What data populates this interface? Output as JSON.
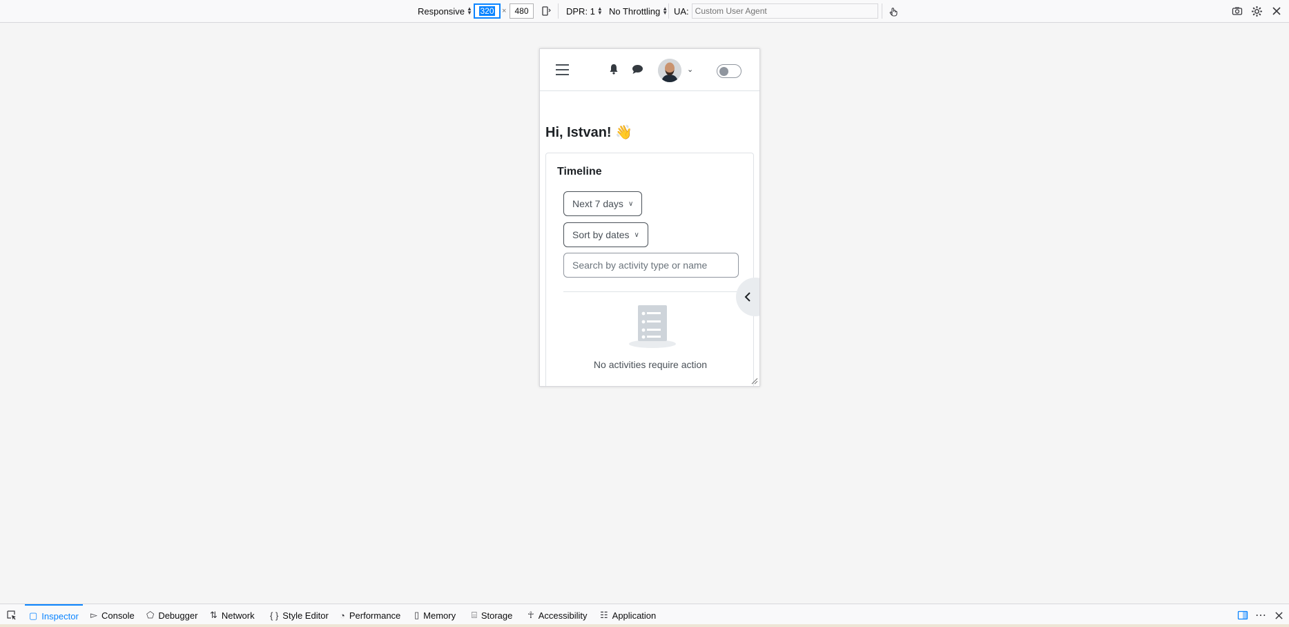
{
  "rdm_toolbar": {
    "device": "Responsive",
    "width": "320",
    "times": "×",
    "height": "480",
    "dpr": "DPR: 1",
    "throttling": "No Throttling",
    "ua_label": "UA:",
    "ua_placeholder": "Custom User Agent",
    "icons": [
      "rotate-icon",
      "touch-icon",
      "screenshot-icon",
      "settings-icon",
      "close-icon"
    ]
  },
  "page": {
    "greeting": "Hi, Istvan! 👋",
    "timeline": {
      "title": "Timeline",
      "filter_label": "Next 7 days",
      "sort_label": "Sort by dates",
      "search_placeholder": "Search by activity type or name",
      "empty_message": "No activities require action"
    },
    "nav_icons": [
      "hamburger-icon",
      "bell-icon",
      "chat-icon",
      "avatar",
      "chevron-down-icon",
      "dark-mode-toggle"
    ]
  },
  "devtools": {
    "tabs": [
      {
        "label": "Inspector",
        "icon": "inspector-icon",
        "selected": true
      },
      {
        "label": "Console",
        "icon": "console-icon"
      },
      {
        "label": "Debugger",
        "icon": "debugger-icon"
      },
      {
        "label": "Network",
        "icon": "network-icon"
      },
      {
        "label": "Style Editor",
        "icon": "style-editor-icon"
      },
      {
        "label": "Performance",
        "icon": "performance-icon"
      },
      {
        "label": "Memory",
        "icon": "memory-icon"
      },
      {
        "label": "Storage",
        "icon": "storage-icon"
      },
      {
        "label": "Accessibility",
        "icon": "accessibility-icon"
      },
      {
        "label": "Application",
        "icon": "application-icon"
      }
    ]
  },
  "colors": {
    "accent": "#0a84ff",
    "toolbar_bg": "#f9f9fa",
    "canvas_bg": "#f5f5f5"
  }
}
